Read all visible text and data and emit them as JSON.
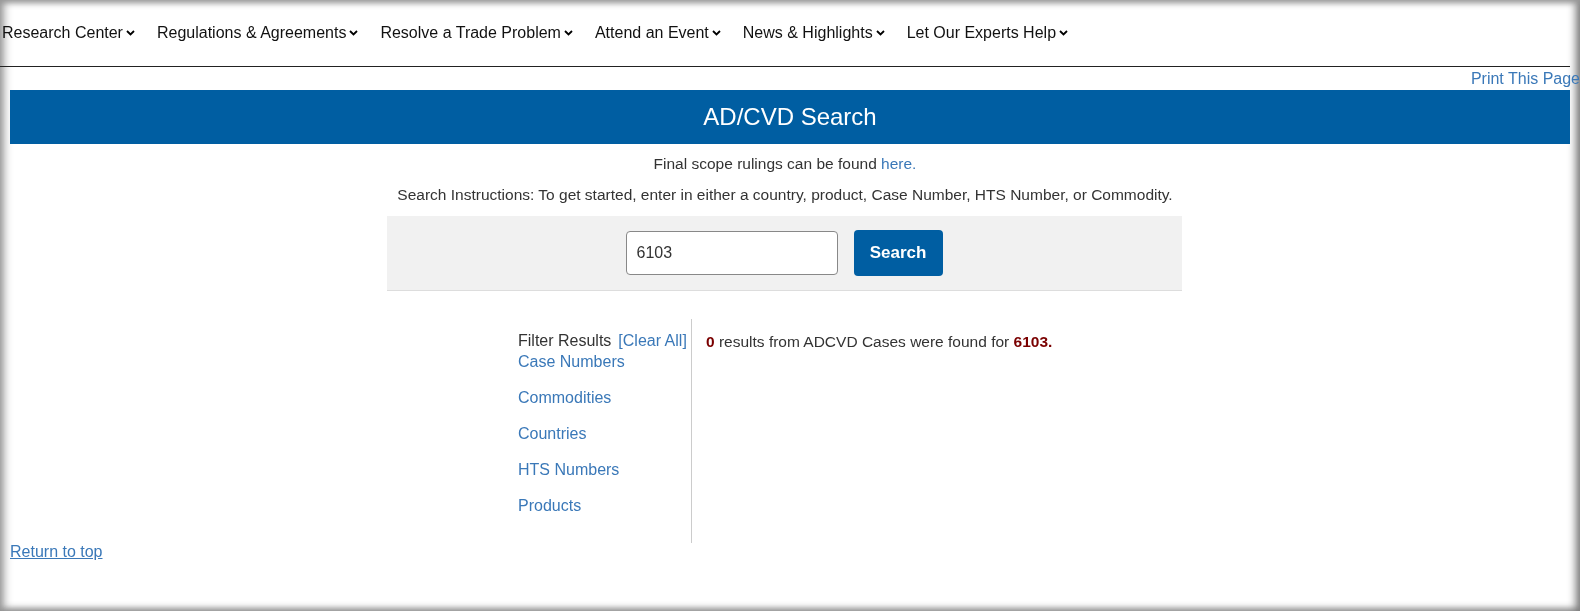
{
  "nav": [
    {
      "label": "Research Center"
    },
    {
      "label": "Regulations & Agreements"
    },
    {
      "label": "Resolve a Trade Problem"
    },
    {
      "label": "Attend an Event"
    },
    {
      "label": "News & Highlights"
    },
    {
      "label": "Let Our Experts Help"
    }
  ],
  "print_link": "Print This Page",
  "banner_title": "AD/CVD Search",
  "scope_note": {
    "text": "Final scope rulings can be found ",
    "link": "here."
  },
  "instructions": "Search Instructions: To get started, enter in either a country, product, Case Number, HTS Number, or Commodity.",
  "search": {
    "value": "6103",
    "button": "Search"
  },
  "filter": {
    "title": "Filter Results",
    "clear": "[Clear All]",
    "items": [
      "Case Numbers",
      "Commodities",
      "Countries",
      "HTS Numbers",
      "Products"
    ]
  },
  "result_message": "**0** results from ADCVD Cases were found for **6103.**",
  "return_link": "Return to top"
}
